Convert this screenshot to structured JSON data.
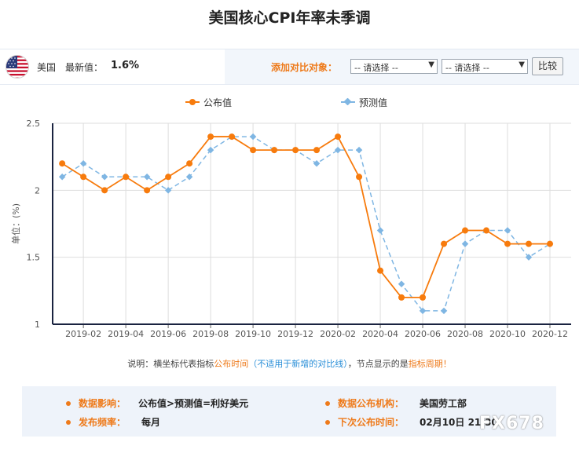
{
  "title": "美国核心CPI年率未季调",
  "header": {
    "country": "美国",
    "latest_label": "最新值：",
    "latest_value": "1.6%",
    "compare_label": "添加对比对象：",
    "select1": "-- 请选择 --",
    "select2": "-- 请选择 --",
    "compare_button": "比较",
    "flag_icon": "us-flag-icon"
  },
  "colors": {
    "actual": "#f77b0d",
    "forecast": "#7fb6e3",
    "accent": "#ee7a1a",
    "link": "#2a8fd8"
  },
  "note": {
    "prefix": "说明：横坐标代表指标",
    "time": "公布时间",
    "paren": "（不适用于新增的对比线）",
    "mid": "，节点显示的是",
    "period": "指标周期！"
  },
  "info": {
    "impact_label": "数据影响：",
    "impact_value": "公布值>预测值=利好美元",
    "freq_label": "发布频率：",
    "freq_value": "每月",
    "org_label": "数据公布机构：",
    "org_value": "美国劳工部",
    "next_label": "下次公布时间：",
    "next_value": "02月10日 21:30"
  },
  "watermark": "FX678",
  "chart_data": {
    "type": "line",
    "title": "美国核心CPI年率未季调",
    "ylabel": "单位：(%)",
    "ylim": [
      1,
      2.5
    ],
    "yticks": [
      1,
      1.5,
      2,
      2.5
    ],
    "ytick_labels": [
      "1",
      "1.5",
      "2",
      "2.5"
    ],
    "x": [
      "2019-01",
      "2019-02",
      "2019-03",
      "2019-04",
      "2019-05",
      "2019-06",
      "2019-07",
      "2019-08",
      "2019-09",
      "2019-10",
      "2019-11",
      "2019-12",
      "2020-01",
      "2020-02",
      "2020-03",
      "2020-04",
      "2020-05",
      "2020-06",
      "2020-07",
      "2020-08",
      "2020-09",
      "2020-10",
      "2020-11",
      "2020-12"
    ],
    "xtick_labels": [
      "2019-02",
      "2019-04",
      "2019-06",
      "2019-08",
      "2019-10",
      "2019-12",
      "2020-02",
      "2020-04",
      "2020-06",
      "2020-08",
      "2020-10",
      "2020-12"
    ],
    "grid": true,
    "legend_position": "top",
    "series": [
      {
        "name": "公布值",
        "style": "solid",
        "color": "#f77b0d",
        "values": [
          2.2,
          2.1,
          2.0,
          2.1,
          2.0,
          2.1,
          2.2,
          2.4,
          2.4,
          2.3,
          2.3,
          2.3,
          2.3,
          2.4,
          2.1,
          1.4,
          1.2,
          1.2,
          1.6,
          1.7,
          1.7,
          1.6,
          1.6,
          1.6
        ]
      },
      {
        "name": "预测值",
        "style": "dashed",
        "color": "#7fb6e3",
        "values": [
          2.1,
          2.2,
          2.1,
          2.1,
          2.1,
          2.0,
          2.1,
          2.3,
          2.4,
          2.4,
          2.3,
          2.3,
          2.2,
          2.3,
          2.3,
          1.7,
          1.3,
          1.1,
          1.1,
          1.6,
          1.7,
          1.7,
          1.5,
          1.6
        ]
      }
    ]
  }
}
